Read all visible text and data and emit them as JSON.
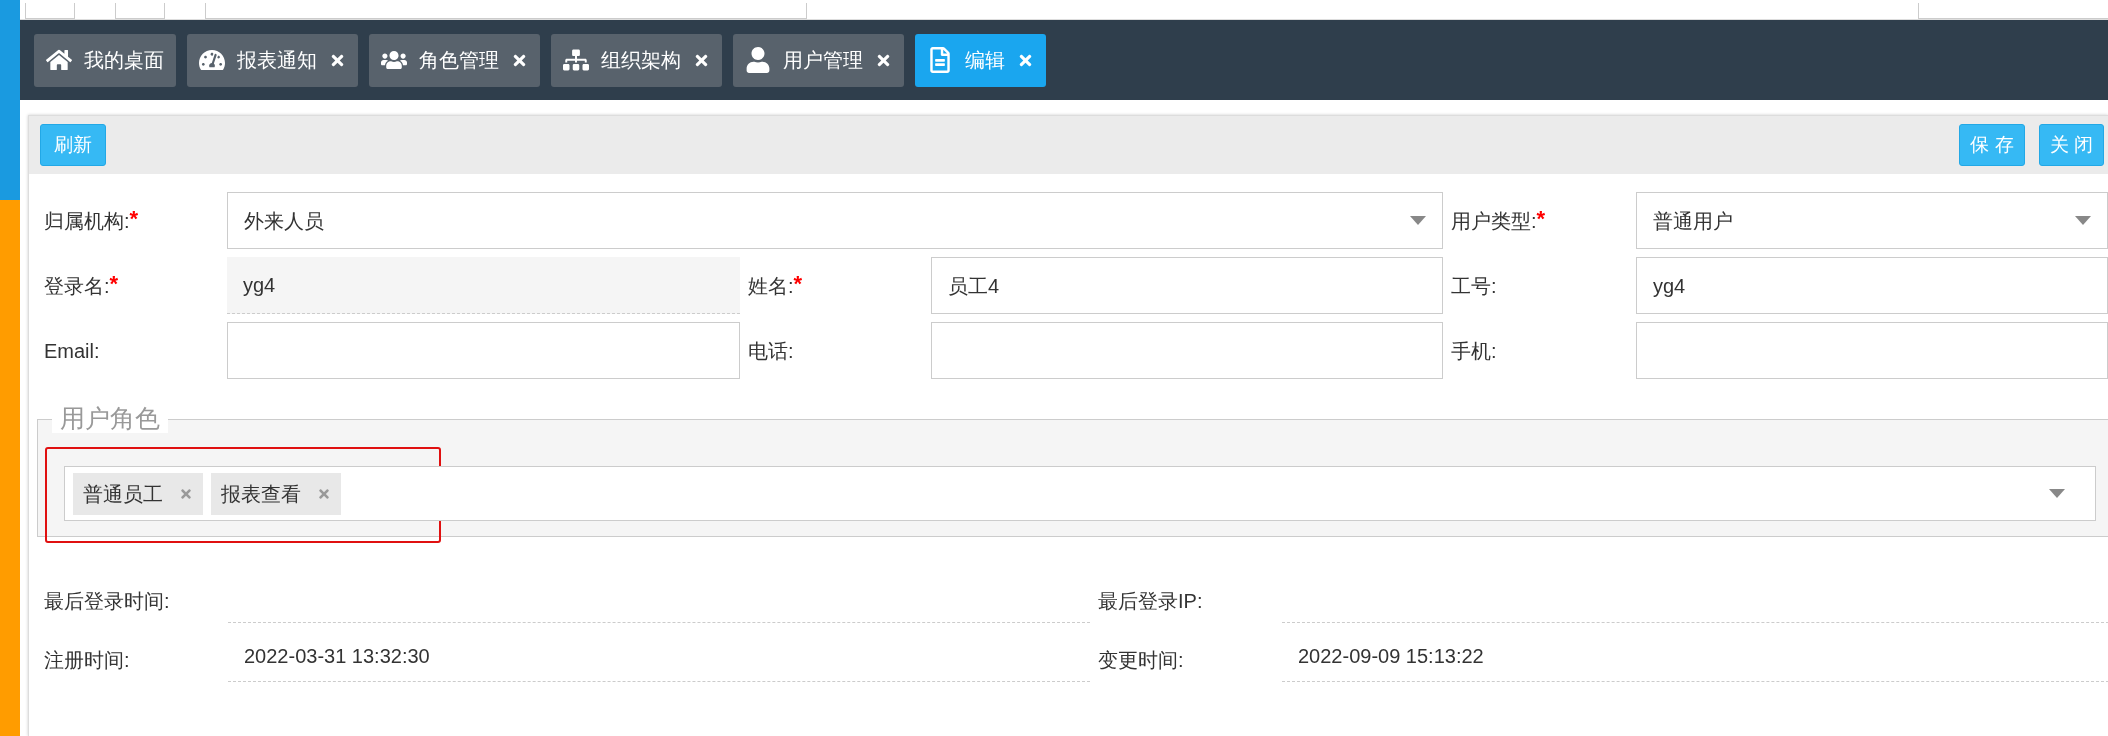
{
  "tabs": [
    {
      "label": "我的桌面",
      "closable": false,
      "selected": false
    },
    {
      "label": "报表通知",
      "closable": true,
      "selected": false
    },
    {
      "label": "角色管理",
      "closable": true,
      "selected": false
    },
    {
      "label": "组织架构",
      "closable": true,
      "selected": false
    },
    {
      "label": "用户管理",
      "closable": true,
      "selected": false
    },
    {
      "label": "编辑",
      "closable": true,
      "selected": true
    }
  ],
  "toolbar": {
    "left_buttons": [
      "刷新"
    ],
    "right_buttons": [
      "保 存",
      "关 闭"
    ]
  },
  "form": {
    "fields": [
      {
        "label": "归属机构:",
        "mark": "*",
        "kind": "select",
        "value": "外来人员",
        "wide": true
      },
      {
        "label": "用户类型:",
        "mark": "*",
        "kind": "select",
        "value": "普通用户",
        "wide": false
      },
      {
        "label": "登录名:",
        "mark": "*",
        "kind": "readonly",
        "value": "yg4",
        "wide": false
      },
      {
        "label": "姓名:",
        "mark": "*",
        "kind": "text",
        "value": "员工4",
        "wide": false
      },
      {
        "label": "工号:",
        "kind": "text",
        "value": "yg4",
        "wide": false
      },
      {
        "label": "Email:",
        "kind": "text",
        "wide": false
      },
      {
        "label": "电话:",
        "kind": "text",
        "wide": false
      },
      {
        "label": "手机:",
        "kind": "text",
        "wide": false
      }
    ]
  },
  "roles": {
    "legend": "用户角色",
    "tags": [
      "普通员工",
      "报表查看"
    ],
    "highlighted": true
  },
  "info": {
    "rows": [
      [
        {
          "label": "最后登录时间:"
        },
        {
          "label": "最后登录IP:"
        }
      ],
      [
        {
          "label": "注册时间:",
          "value": "2022-03-31 13:32:30"
        },
        {
          "label": "变更时间:",
          "value": "2022-09-09 15:13:22"
        }
      ]
    ]
  }
}
